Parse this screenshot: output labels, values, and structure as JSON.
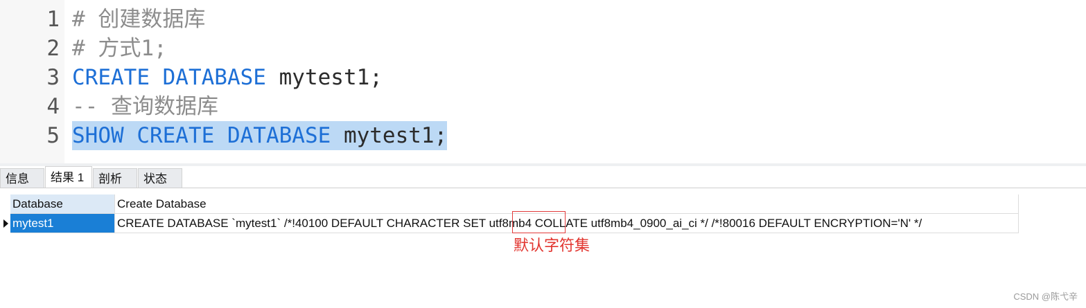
{
  "editor": {
    "lines": [
      {
        "number": "1",
        "comment": "# 创建数据库"
      },
      {
        "number": "2",
        "comment": "# 方式1;"
      },
      {
        "number": "3",
        "keyword": "CREATE DATABASE",
        "ident": " mytest1;"
      },
      {
        "number": "4",
        "comment": "-- 查询数据库"
      },
      {
        "number": "5",
        "keyword": "SHOW CREATE DATABASE",
        "ident": " mytest1;",
        "selected": true
      }
    ]
  },
  "result_tabs": [
    {
      "label": "信息",
      "active": false
    },
    {
      "label": "结果 1",
      "active": true
    },
    {
      "label": "剖析",
      "active": false
    },
    {
      "label": "状态",
      "active": false
    }
  ],
  "grid": {
    "columns": [
      "Database",
      "Create Database"
    ],
    "rows": [
      {
        "database": "mytest1",
        "create_prefix": "CREATE DATABASE `mytest1` /*!40100 DEFAULT CHARACTER SET ",
        "create_charset": "utf8mb4",
        "create_suffix": " COLLATE utf8mb4_0900_ai_ci */ /*!80016 DEFAULT ENCRYPTION='N' */",
        "selected": true
      }
    ]
  },
  "annotation": {
    "text": "默认字符集",
    "color": "#e2352f"
  },
  "watermark": "CSDN @陈弋辛",
  "colors": {
    "keyword": "#1d6fd6",
    "comment": "#8c8c8c",
    "selection": "#bcd9f5",
    "row_selected": "#1a7fd6"
  }
}
